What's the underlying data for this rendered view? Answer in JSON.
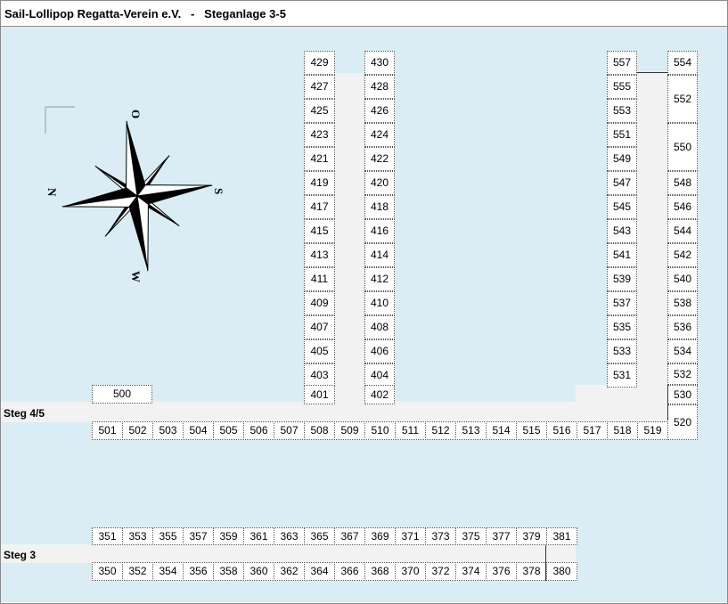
{
  "title": "Sail-Lollipop Regatta-Verein e.V.   -   Steganlage 3-5",
  "compass": {
    "top": "O",
    "left": "N",
    "right": "S",
    "bottom": "W"
  },
  "piers": {
    "steg45": "Steg 4/5",
    "steg3": "Steg 3"
  },
  "colors": {
    "water": "#daedf4",
    "pier": "#f2f2f2",
    "slot": "#ffffff"
  },
  "berths": {
    "col_429": [
      "429",
      "427",
      "425",
      "423",
      "421",
      "419",
      "417",
      "415",
      "413",
      "411",
      "409",
      "407",
      "405",
      "403",
      "401"
    ],
    "col_430": [
      "430",
      "428",
      "426",
      "424",
      "422",
      "420",
      "418",
      "416",
      "414",
      "412",
      "410",
      "408",
      "406",
      "404",
      "402"
    ],
    "col_557": [
      "557",
      "555",
      "553",
      "551",
      "549",
      "547",
      "545",
      "543",
      "541",
      "539",
      "537",
      "535",
      "533",
      "531"
    ],
    "col_554": [
      "554",
      "552",
      "550",
      "548",
      "546",
      "544",
      "542",
      "540",
      "538",
      "536",
      "534",
      "532",
      "530",
      "520"
    ],
    "b500": "500",
    "row_500": [
      "501",
      "502",
      "503",
      "504",
      "505",
      "506",
      "507",
      "508",
      "509",
      "510",
      "511",
      "512",
      "513",
      "514",
      "515",
      "516",
      "517",
      "518",
      "519"
    ],
    "row_350_top": [
      "351",
      "353",
      "355",
      "357",
      "359",
      "361",
      "363",
      "365",
      "367",
      "369",
      "371",
      "373",
      "375",
      "377",
      "379",
      "381"
    ],
    "row_350_bottom": [
      "350",
      "352",
      "354",
      "356",
      "358",
      "360",
      "362",
      "364",
      "366",
      "368",
      "370",
      "372",
      "374",
      "376",
      "378",
      "380"
    ]
  }
}
